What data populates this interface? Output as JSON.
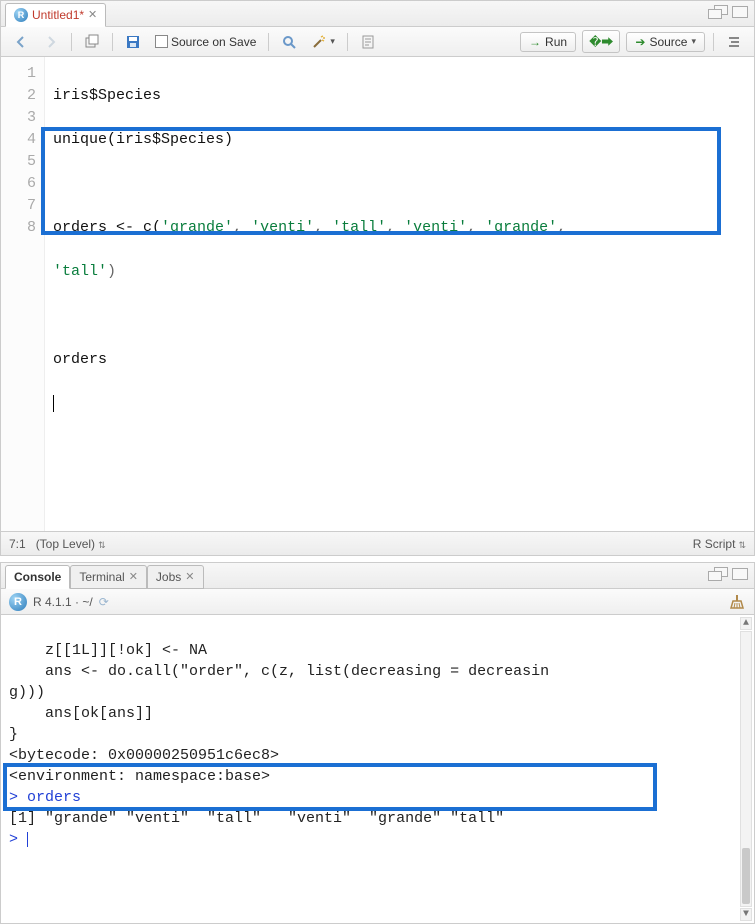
{
  "editor_pane": {
    "tab": {
      "title": "Untitled1*",
      "modified": true
    },
    "toolbar": {
      "source_on_save_label": "Source on Save",
      "run_label": "Run",
      "source_label": "Source"
    },
    "code_lines": {
      "l1": "iris$Species",
      "l2": "unique(iris$Species)",
      "l3": "",
      "l4a": "orders <- c(",
      "l4b_strs": [
        "'grande'",
        "'venti'",
        "'tall'",
        "'venti'",
        "'grande'"
      ],
      "l4c": ",",
      "l4wrap_str": "'tall'",
      "l4wrap_tail": ")",
      "l5": "",
      "l6": "orders",
      "l7": "",
      "l8": ""
    },
    "gutter": [
      "1",
      "2",
      "3",
      "4",
      "",
      "5",
      "6",
      "7",
      "8"
    ],
    "status": {
      "cursor": "7:1",
      "scope": "(Top Level)",
      "lang": "R Script"
    }
  },
  "console_pane": {
    "tabs": {
      "console": "Console",
      "terminal": "Terminal",
      "jobs": "Jobs"
    },
    "session": {
      "r_label": "R 4.1.1",
      "path": "~/"
    },
    "output_lines": {
      "o1": "    z[[1L]][!ok] <- NA",
      "o2": "    ans <- do.call(\"order\", c(z, list(decreasing = decreasin",
      "o3": "g)))",
      "o4": "    ans[ok[ans]]",
      "o5": "}",
      "o6": "<bytecode: 0x00000250951c6ec8>",
      "o7": "<environment: namespace:base>",
      "o8_prompt": ">",
      "o8_cmd": "orders",
      "o9": "[1] \"grande\" \"venti\"  \"tall\"   \"venti\"  \"grande\" \"tall\"  ",
      "o10_prompt": ">"
    }
  }
}
